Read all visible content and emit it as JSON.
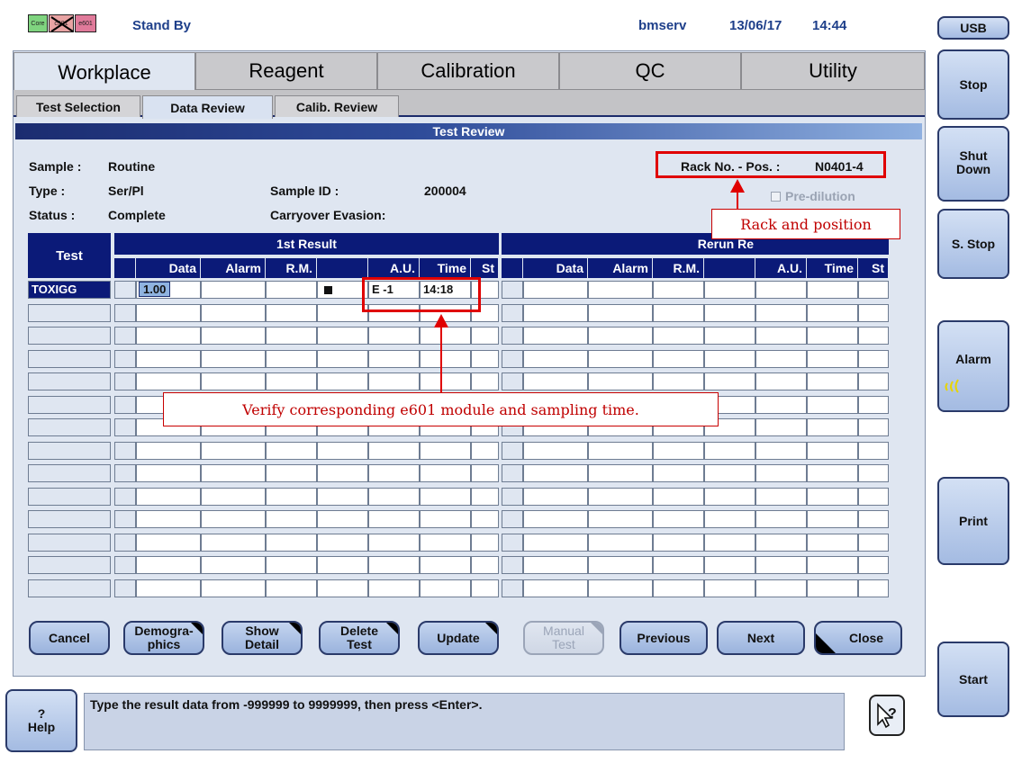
{
  "status_bar": {
    "modules": [
      "Core",
      "c501",
      "e601"
    ],
    "state": "Stand By",
    "user": "bmserv",
    "date": "13/06/17",
    "time": "14:44"
  },
  "main_tabs": [
    "Workplace",
    "Reagent",
    "Calibration",
    "QC",
    "Utility"
  ],
  "sub_tabs": [
    "Test Selection",
    "Data Review",
    "Calib. Review"
  ],
  "window_title": "Test Review",
  "sample_info": {
    "sample_label": "Sample :",
    "sample_value": "Routine",
    "type_label": "Type :",
    "type_value": "Ser/Pl",
    "status_label": "Status :",
    "status_value": "Complete",
    "sample_id_label": "Sample ID :",
    "sample_id_value": "200004",
    "carryover_label": "Carryover Evasion:",
    "rack_label": "Rack No. - Pos. :",
    "rack_value": "N0401-4",
    "pre_dilution_label": "Pre-dilution"
  },
  "table": {
    "test_header": "Test",
    "first_result_header": "1st Result",
    "rerun_result_header": "Rerun Re",
    "columns_first": [
      "Data",
      "Alarm",
      "R.M.",
      "",
      "A.U.",
      "Time",
      "St"
    ],
    "columns_rerun": [
      "Data",
      "Alarm",
      "R.M.",
      "",
      "A.U.",
      "Time",
      "St"
    ],
    "rows": [
      {
        "test": "TOXIGG",
        "data": "1.00",
        "alarm": "",
        "rm": "",
        "au": "E -1",
        "time": "14:18",
        "st": ""
      }
    ]
  },
  "buttons": {
    "cancel": "Cancel",
    "demographics": "Demogra-\nphics",
    "show_detail": "Show\nDetail",
    "delete_test": "Delete\nTest",
    "update": "Update",
    "manual_test": "Manual\nTest",
    "previous": "Previous",
    "next": "Next",
    "close": "Close"
  },
  "message": "Type the result data from -999999 to 9999999, then press <Enter>.",
  "help_button": {
    "symbol": "?",
    "label": "Help"
  },
  "right_panel": {
    "usb": "USB",
    "stop": "Stop",
    "shutdown": "Shut\nDown",
    "s_stop": "S. Stop",
    "alarm": "Alarm",
    "print": "Print",
    "start": "Start"
  },
  "annotations": {
    "rack_callout": "Rack and position",
    "module_callout": "Verify corresponding e601 module and sampling time."
  },
  "colors": {
    "header_navy": "#0b1a78",
    "panel_bg": "#dfe6f1",
    "annotation_red": "#e00000"
  }
}
